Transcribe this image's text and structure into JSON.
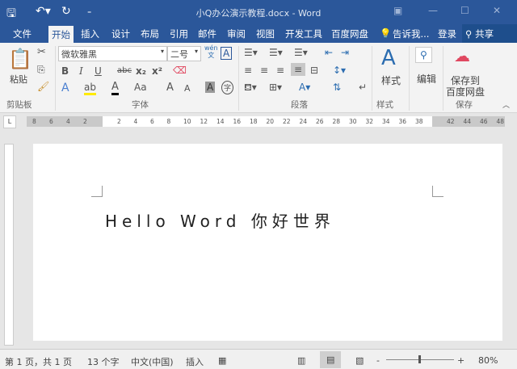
{
  "window": {
    "title": "小Q办公演示教程.docx - Word"
  },
  "tabs": [
    "文件",
    "开始",
    "插入",
    "设计",
    "布局",
    "引用",
    "邮件",
    "审阅",
    "视图",
    "开发工具",
    "百度网盘"
  ],
  "tell_me": "告诉我...",
  "login": "登录",
  "share": "共享",
  "ribbon": {
    "clipboard": {
      "paste": "粘贴",
      "group": "剪贴板"
    },
    "font": {
      "name": "微软雅黑",
      "size": "二号",
      "group": "字体",
      "bold": "B",
      "italic": "I",
      "underline": "U",
      "strike": "abc",
      "sub": "x₂",
      "sup": "x²",
      "case": "Aa",
      "grow": "A",
      "shrink": "A",
      "phonetic_top": "wén",
      "phonetic_bottom": "文",
      "border_char": "A",
      "shade_char": "A",
      "enclose": "字"
    },
    "paragraph": {
      "group": "段落"
    },
    "styles": {
      "label": "样式",
      "group": "样式"
    },
    "editing": {
      "label": "编辑"
    },
    "save": {
      "label1": "保存到",
      "label2": "百度网盘",
      "group": "保存"
    }
  },
  "ruler": {
    "left": [
      "8",
      "6",
      "4",
      "2"
    ],
    "main": [
      "2",
      "4",
      "6",
      "8",
      "10",
      "12",
      "14",
      "16",
      "18",
      "20",
      "22",
      "24",
      "26",
      "28",
      "30",
      "32",
      "34",
      "36",
      "38"
    ],
    "right": [
      "42",
      "44",
      "46",
      "48"
    ],
    "tab_selector": "L"
  },
  "document": {
    "text": "Hello Word 你好世界"
  },
  "status": {
    "page": "第 1 页，共 1 页",
    "words": "13 个字",
    "language": "中文(中国)",
    "mode": "插入",
    "zoom": "80%",
    "zoom_percent": 80
  }
}
